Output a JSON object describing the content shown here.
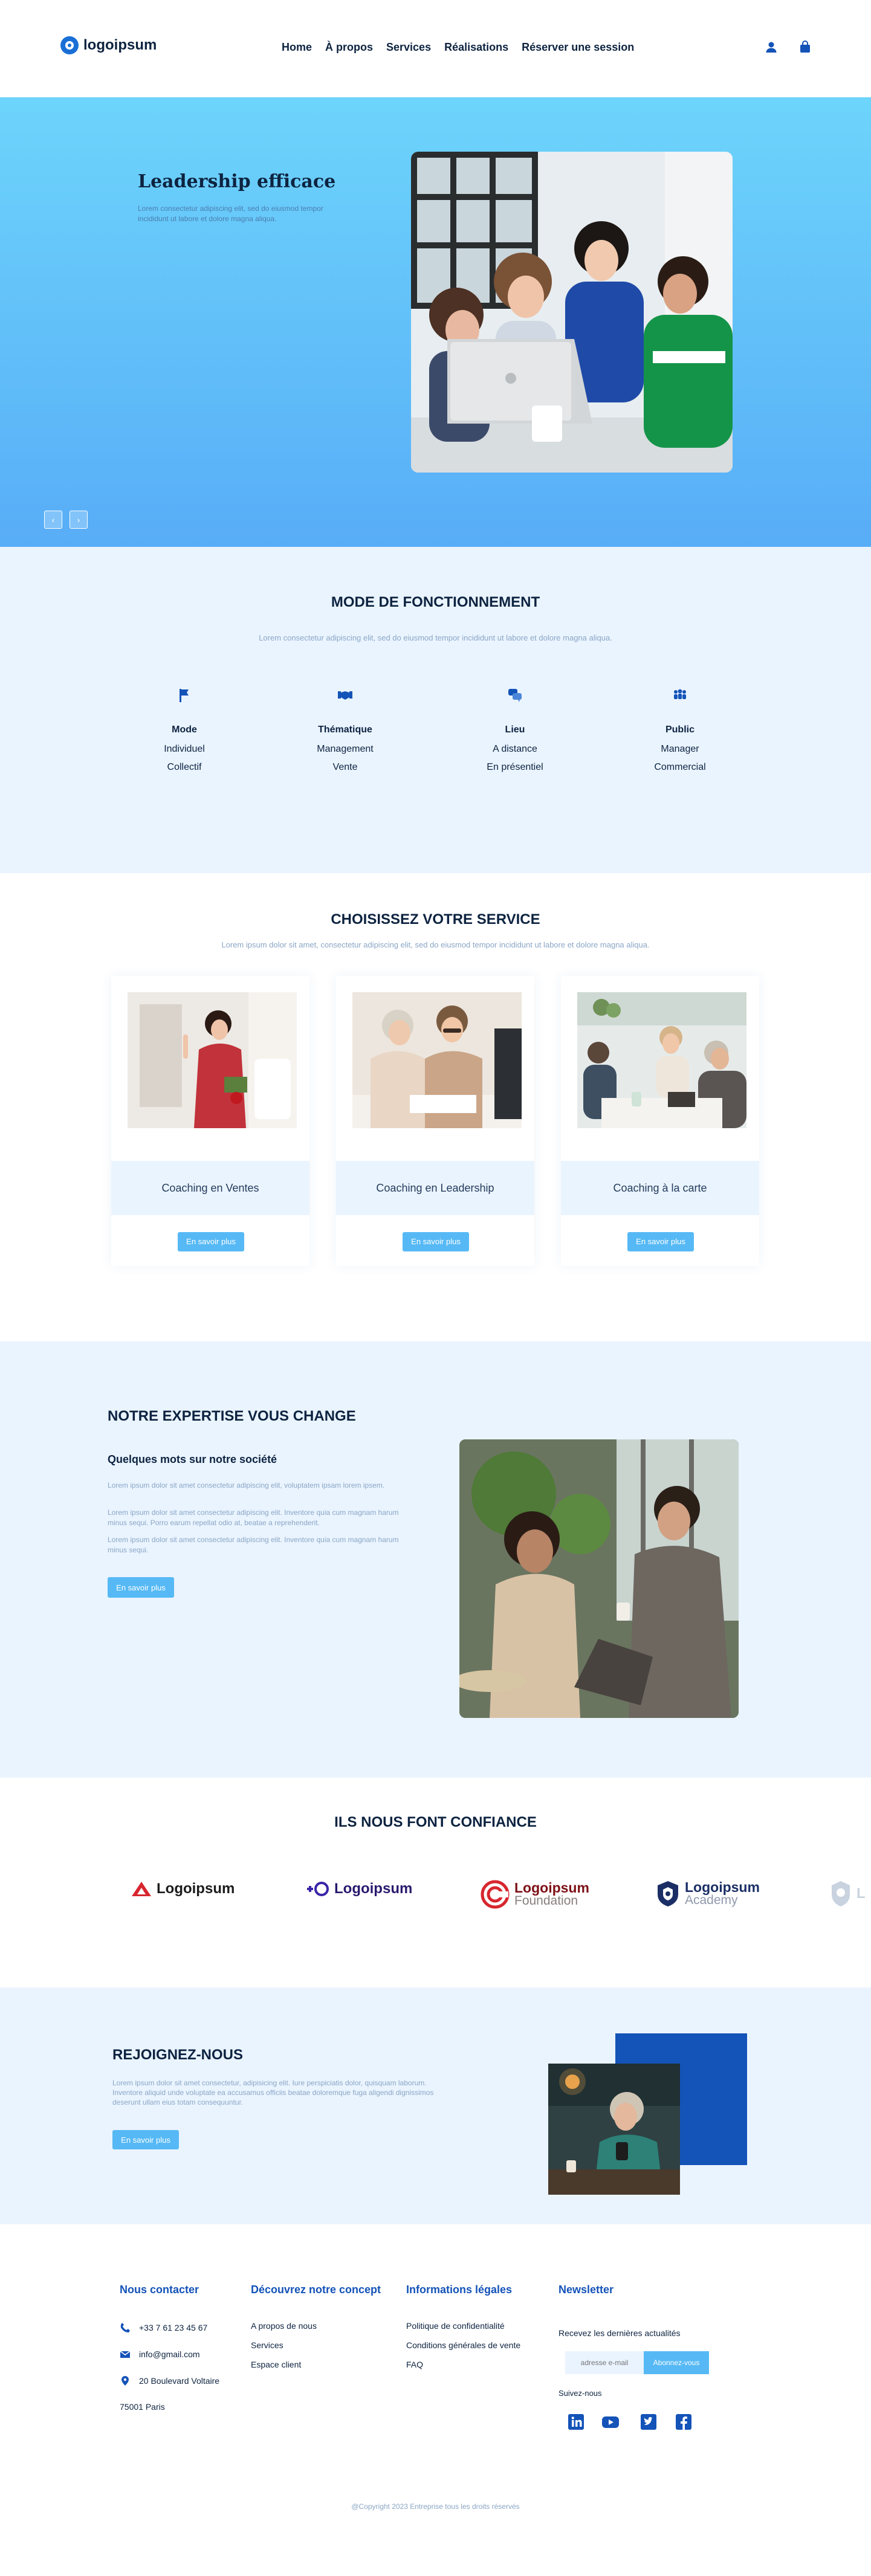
{
  "header": {
    "logo_text": "logoipsum",
    "nav": [
      "Home",
      "À propos",
      "Services",
      "Réalisations",
      "Réserver une session"
    ]
  },
  "hero": {
    "title": "Leadership efficace",
    "subtitle": "Lorem consectetur adipiscing elit, sed do eiusmod tempor incididunt ut labore et dolore magna aliqua.",
    "prev_label": "‹",
    "next_label": "›"
  },
  "mode": {
    "title": "MODE DE FONCTIONNEMENT",
    "subtitle": "Lorem consectetur adipiscing elit, sed do eiusmod tempor incididunt ut labore et dolore magna aliqua.",
    "columns": [
      {
        "label": "Mode",
        "values": [
          "Individuel",
          "Collectif"
        ],
        "icon": "flag-icon"
      },
      {
        "label": "Thématique",
        "values": [
          "Management",
          "Vente"
        ],
        "icon": "handshake-icon"
      },
      {
        "label": "Lieu",
        "values": [
          "A distance",
          "En présentiel"
        ],
        "icon": "chat-icon"
      },
      {
        "label": "Public",
        "values": [
          "Manager",
          "Commercial"
        ],
        "icon": "users-icon"
      }
    ]
  },
  "services": {
    "title": "CHOISISSEZ VOTRE SERVICE",
    "subtitle": "Lorem ipsum dolor sit amet, consectetur adipiscing elit, sed do eiusmod tempor incididunt ut labore et dolore magna aliqua.",
    "cards": [
      {
        "title": "Coaching en Ventes",
        "button": "En savoir plus"
      },
      {
        "title": "Coaching en Leadership",
        "button": "En savoir plus"
      },
      {
        "title": "Coaching à la carte",
        "button": "En savoir plus"
      }
    ]
  },
  "expertise": {
    "title": "NOTRE EXPERTISE VOUS CHANGE",
    "subtitle": "Quelques mots sur notre société",
    "paragraphs": [
      "Lorem ipsum dolor sit amet consectetur adipiscing elit, voluptatem ipsam lorem ipsem.",
      "Lorem ipsum dolor sit amet consectetur adipiscing elit. Inventore quia cum magnam harum minus sequi. Porro earum repellat odio at, beatae a reprehenderit.",
      "Lorem ipsum dolor sit amet consectetur adipiscing elit. Inventore quia cum magnam harum minus sequi."
    ],
    "button": "En savoir plus"
  },
  "trust": {
    "title": "ILS NOUS FONT CONFIANCE",
    "partners": [
      {
        "name": "Logoipsum",
        "color": "#d7262e"
      },
      {
        "name": "Logoipsum",
        "color": "#3b25a8"
      },
      {
        "name": "Logoipsum",
        "sub": "Foundation",
        "color": "#7d1117"
      },
      {
        "name": "Logoipsum",
        "sub": "Academy",
        "color": "#1b2f66"
      },
      {
        "name": "L",
        "color": "#9aa8bf"
      }
    ]
  },
  "join": {
    "title": "REJOIGNEZ-NOUS",
    "text": "Lorem ipsum dolor sit amet consectetur, adipisicing elit. Iure perspiciatis dolor, quisquam laborum. Inventore aliquid unde voluptate ea accusamus officiis beatae doloremque fuga aligendi dignissimos deserunt ullam eius totam consequuntur.",
    "button": "En savoir plus"
  },
  "footer": {
    "contact": {
      "title": "Nous contacter",
      "phone": "+33 7 61 23 45 67",
      "email": "info@gmail.com",
      "address1": "20 Boulevard Voltaire",
      "address2": "75001 Paris"
    },
    "concept": {
      "title": "Découvrez notre concept",
      "links": [
        "A propos de nous",
        "Services",
        "Espace client"
      ]
    },
    "legal": {
      "title": "Informations légales",
      "links": [
        "Politique de confidentialité",
        "Conditions générales de vente",
        "FAQ"
      ]
    },
    "newsletter": {
      "title": "Newsletter",
      "text": "Recevez les dernières actualités",
      "placeholder": "adresse e-mail",
      "button": "Abonnez-vous",
      "follow": "Suivez-nous"
    },
    "copyright": "@Copyright 2023 Entreprise tous les droits réservés"
  },
  "colors": {
    "primary": "#1453b8",
    "accent": "#56b9f5",
    "light_bg": "#eaf4ff",
    "dark": "#0d2340"
  }
}
